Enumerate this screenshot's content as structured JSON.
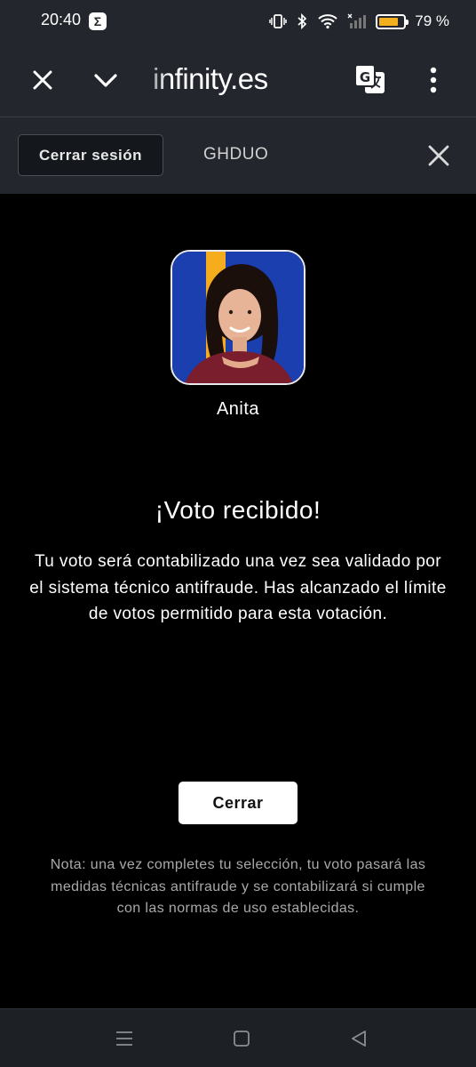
{
  "status_bar": {
    "time": "20:40",
    "app_icon_glyph": "Σ",
    "battery_percent": 79,
    "battery_label": "79 %",
    "battery_color": "#f2b01e",
    "icons": [
      "vibrate-icon",
      "bluetooth-icon",
      "wifi-icon",
      "signal-icon",
      "battery-icon"
    ]
  },
  "browser": {
    "url": "infinity.es",
    "icons": [
      "close-icon",
      "chevron-down-icon",
      "translate-icon",
      "more-vert-icon"
    ]
  },
  "session": {
    "logout_label": "Cerrar sesión",
    "user_code": "GHDUO"
  },
  "contestant": {
    "name": "Anita",
    "photo_colors": {
      "background": "#1b3fae",
      "stripe": "#f5ac1d",
      "hair": "#1a0f0b",
      "skin": "#e8b497",
      "top": "#7a1d2c"
    }
  },
  "result": {
    "title": "¡Voto recibido!",
    "message": "Tu voto será contabilizado una vez sea validado por el sistema técnico antifraude. Has alcanzado el límite de votos permitido para esta votación.",
    "close_label": "Cerrar",
    "note": "Nota: una vez completes tu selección, tu voto pasará las medidas técnicas antifraude y se contabilizará si cumple con las normas de uso establecidas."
  },
  "nav_bar": {
    "icons": [
      "menu-icon",
      "home-icon",
      "back-icon"
    ]
  }
}
